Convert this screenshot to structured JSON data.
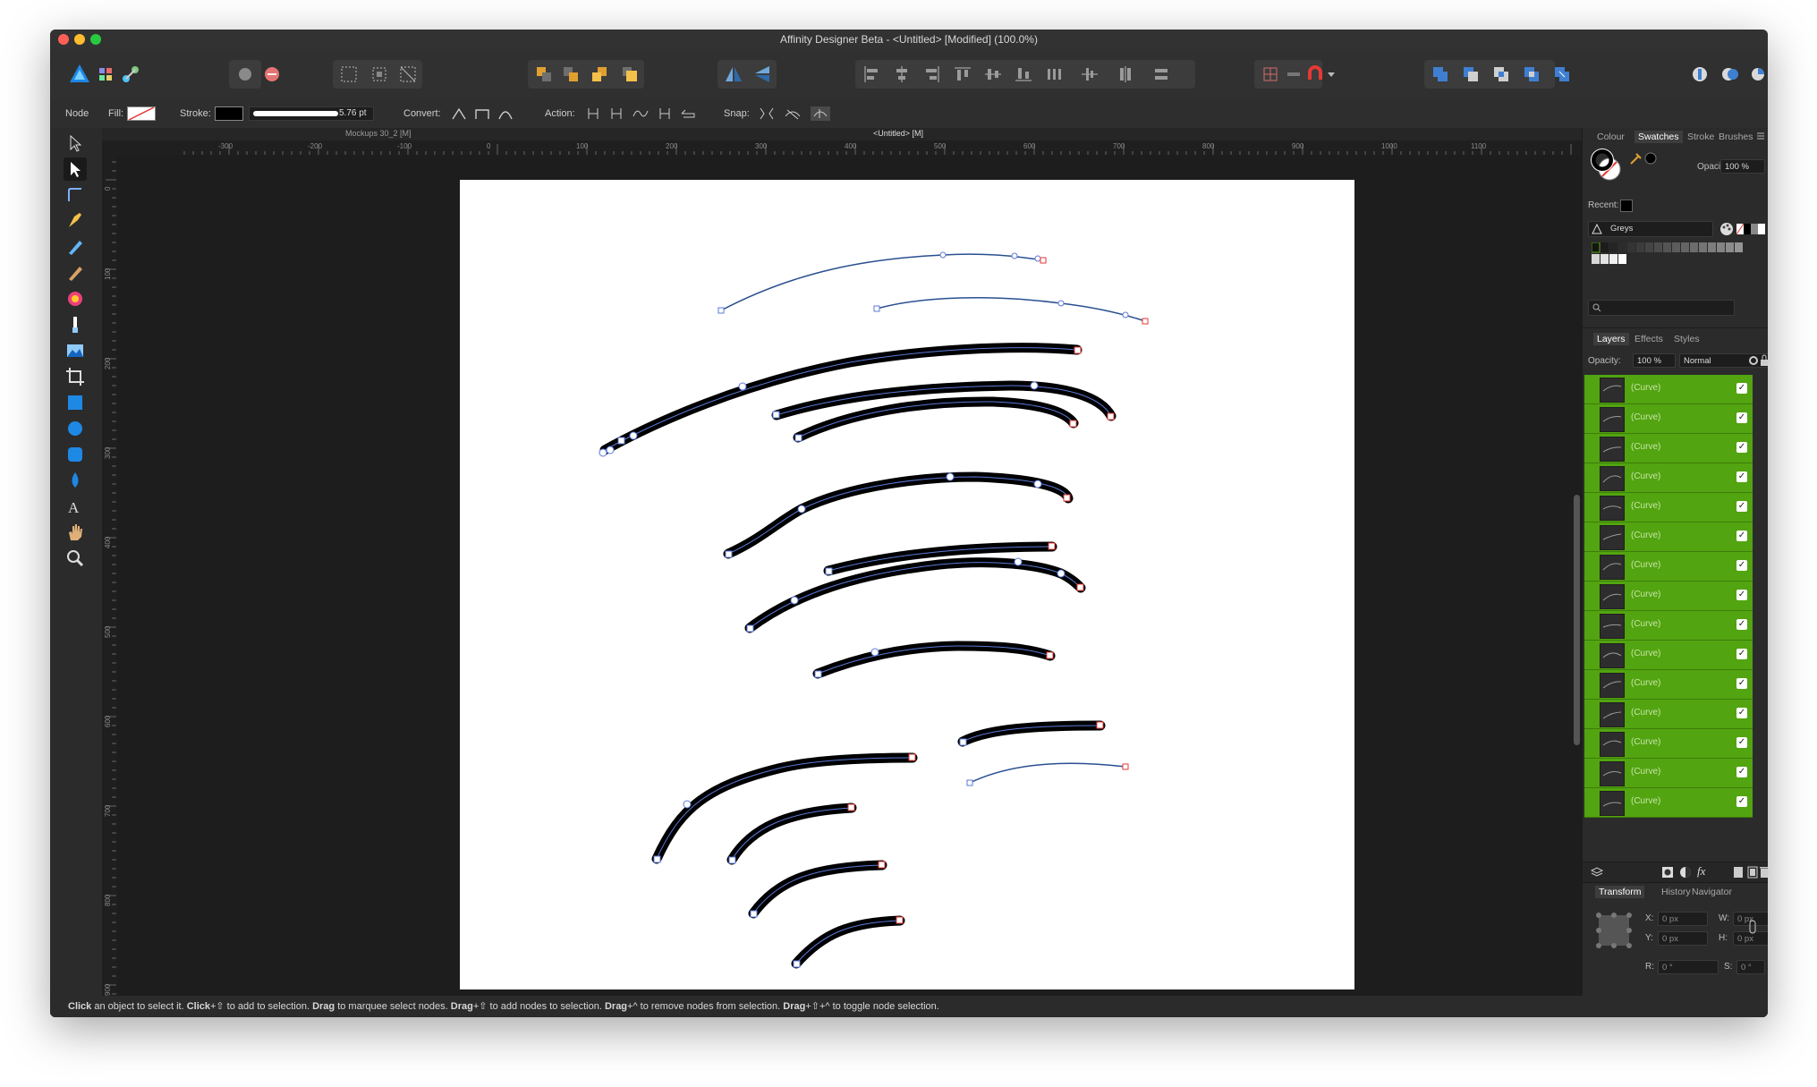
{
  "window": {
    "title": "Affinity Designer Beta - <Untitled> [Modified] (100.0%)"
  },
  "context_toolbar": {
    "tool_name": "Node",
    "fill_label": "Fill:",
    "stroke_label": "Stroke:",
    "stroke_width": "5.76 pt",
    "convert_label": "Convert:",
    "action_label": "Action:",
    "snap_label": "Snap:"
  },
  "document_tabs": [
    "Mockups 30_2 [M]",
    "<Untitled> [M]"
  ],
  "rulers": {
    "unit": "px",
    "horizontal_labels": [
      "-300",
      "-200",
      "-100",
      "0",
      "100",
      "200",
      "300",
      "400",
      "500",
      "600",
      "700",
      "800",
      "900",
      "1000",
      "1100"
    ],
    "vertical_labels": [
      "0",
      "100",
      "200",
      "300",
      "400",
      "500",
      "600",
      "700",
      "800",
      "900"
    ]
  },
  "tools": [
    "move-tool",
    "node-tool",
    "corner-tool",
    "pen-tool",
    "pencil-tool",
    "vector-brush-tool",
    "fill-tool",
    "transparency-tool",
    "place-image-tool",
    "crop-tool",
    "rectangle-tool",
    "ellipse-tool",
    "rounded-rectangle-tool",
    "shape-tool",
    "artistic-text-tool",
    "view-tool",
    "zoom-tool"
  ],
  "right_panel": {
    "top_tabs": [
      "Colour",
      "Swatches",
      "Stroke",
      "Brushes"
    ],
    "active_top_tab": "Swatches",
    "opacity_label": "Opacity:",
    "opacity_value": "100 %",
    "recent_label": "Recent:",
    "palette_name": "Greys",
    "search_placeholder": "",
    "layer_tabs": [
      "Layers",
      "Effects",
      "Styles"
    ],
    "active_layer_tab": "Layers",
    "layer_opacity_label": "Opacity:",
    "layer_opacity_value": "100 %",
    "blend_mode": "Normal",
    "layers": [
      "(Curve)",
      "(Curve)",
      "(Curve)",
      "(Curve)",
      "(Curve)",
      "(Curve)",
      "(Curve)",
      "(Curve)",
      "(Curve)",
      "(Curve)",
      "(Curve)",
      "(Curve)",
      "(Curve)",
      "(Curve)",
      "(Curve)"
    ],
    "transform_tabs": [
      "Transform",
      "History",
      "Navigator"
    ],
    "active_transform_tab": "Transform",
    "transform": {
      "x_label": "X:",
      "x_value": "0 px",
      "y_label": "Y:",
      "y_value": "0 px",
      "w_label": "W:",
      "w_value": "0 px",
      "h_label": "H:",
      "h_value": "0 px",
      "r_label": "R:",
      "r_value": "0 °",
      "s_label": "S:",
      "s_value": "0 °"
    }
  },
  "status_bar": {
    "t1": "Click",
    "t2": " an object to select it. ",
    "t3": "Click",
    "t4": "+⇧ to add to selection. ",
    "t5": "Drag",
    "t6": " to marquee select nodes. ",
    "t7": "Drag",
    "t8": "+⇧ to add nodes to selection. ",
    "t9": "Drag",
    "t10": "+^ to remove nodes from selection. ",
    "t11": "Drag",
    "t12": "+⇧+^ to toggle node selection."
  },
  "colors": {
    "selection_green": "#52a410",
    "affinity_blue": "#1e88e5",
    "curve_stroke": "#000000",
    "path_line": "#5b7ad8"
  }
}
